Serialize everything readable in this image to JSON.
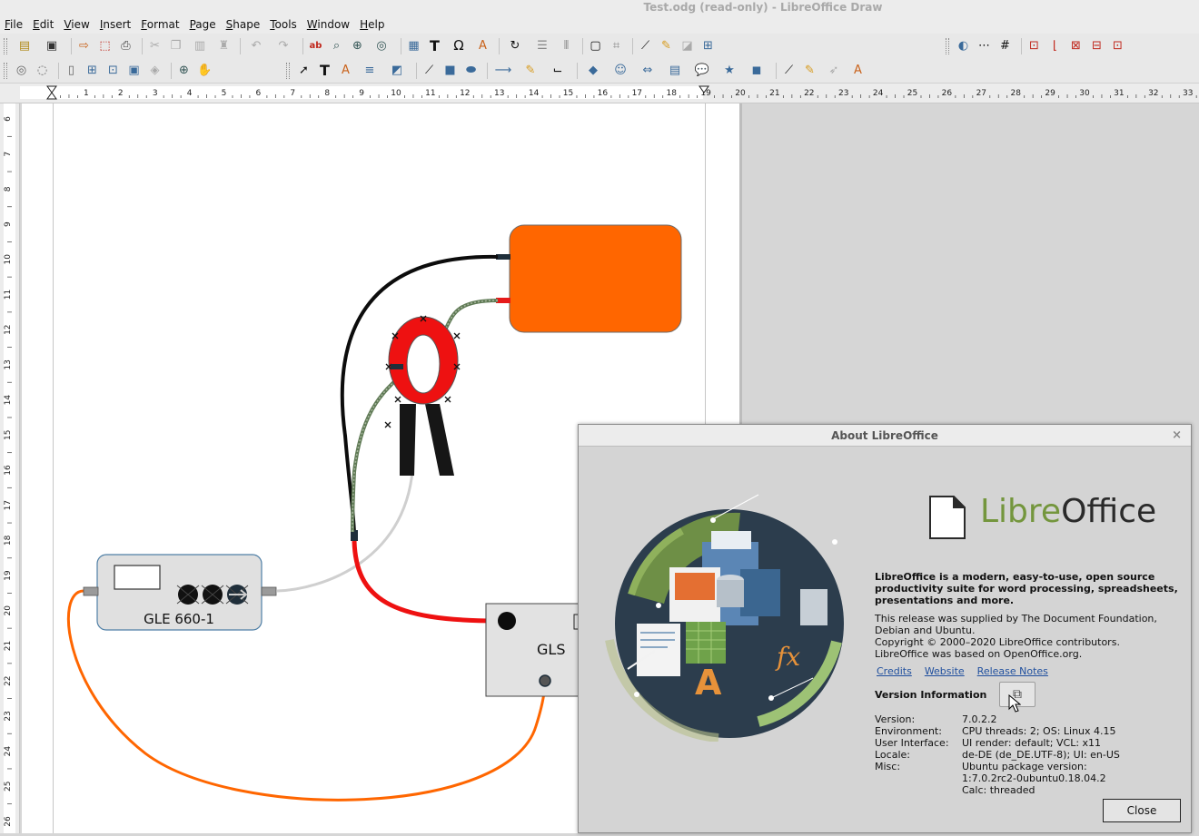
{
  "window": {
    "title": "Test.odg (read-only) - LibreOffice Draw"
  },
  "menu": [
    {
      "first": "F",
      "rest": "ile"
    },
    {
      "first": "E",
      "rest": "dit"
    },
    {
      "first": "V",
      "rest": "iew"
    },
    {
      "first": "I",
      "rest": "nsert"
    },
    {
      "first": "F",
      "rest": "ormat"
    },
    {
      "first": "P",
      "rest": "age"
    },
    {
      "first": "S",
      "rest": "hape"
    },
    {
      "first": "T",
      "rest": "ools"
    },
    {
      "first": "W",
      "rest": "indow"
    },
    {
      "first": "H",
      "rest": "elp"
    }
  ],
  "ruler": {
    "h_labels": [
      "1",
      "2",
      "3",
      "4",
      "5",
      "6",
      "7",
      "8",
      "9",
      "10",
      "11",
      "12",
      "13",
      "14",
      "15",
      "16",
      "17",
      "18",
      "19",
      "20",
      "21",
      "22",
      "23",
      "24",
      "25",
      "26",
      "27",
      "28",
      "29",
      "30",
      "31",
      "32",
      "33"
    ],
    "v_labels": [
      "6",
      "7",
      "8",
      "9",
      "10",
      "11",
      "12",
      "13",
      "14",
      "15",
      "16",
      "17",
      "18",
      "19",
      "20",
      "21",
      "22",
      "23",
      "24",
      "25",
      "26"
    ]
  },
  "canvas": {
    "gle_label": "GLE 660-1",
    "gls_label": "GLS",
    "colors": {
      "orange": "#ff6600",
      "red": "#ee1111",
      "cable_green": "#5f7a55",
      "gray_cable": "#cfcfcf"
    }
  },
  "about": {
    "title": "About LibreOffice",
    "logo_part1": "Libre",
    "logo_part2": "Office",
    "description": "LibreOffice is a modern, easy-to-use, open source productivity suite for word processing, spreadsheets, presentations and more.",
    "supplied": "This release was supplied by The Document Foundation, Debian and Ubuntu.",
    "copyright": "Copyright © 2000–2020 LibreOffice contributors.",
    "based": "LibreOffice was based on OpenOffice.org.",
    "links": {
      "credits": "Credits",
      "website": "Website",
      "release_notes": "Release Notes"
    },
    "version_info_label": "Version Information",
    "info": [
      {
        "k": "Version:",
        "v": "7.0.2.2"
      },
      {
        "k": "Environment:",
        "v": "CPU threads: 2; OS: Linux 4.15"
      },
      {
        "k": "User Interface:",
        "v": "UI render: default; VCL: x11"
      },
      {
        "k": "Locale:",
        "v": "de-DE (de_DE.UTF-8); UI: en-US"
      },
      {
        "k": "Misc:",
        "v": "Ubuntu package version:"
      },
      {
        "k": "",
        "v": "1:7.0.2rc2-0ubuntu0.18.04.2"
      },
      {
        "k": "",
        "v": "Calc: threaded"
      }
    ],
    "close_label": "Close"
  }
}
